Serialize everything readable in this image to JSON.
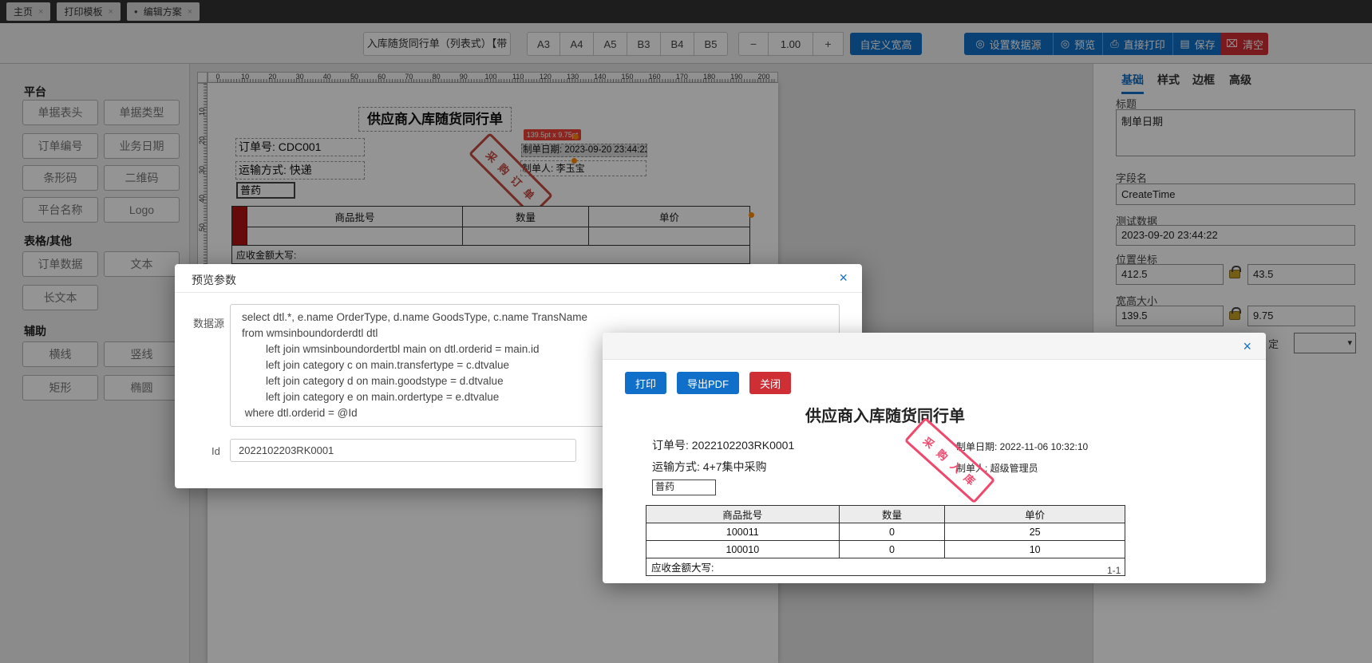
{
  "colors": {
    "primary": "#1070c9",
    "danger": "#cf2e35",
    "tabbar_bg": "#333333",
    "stamp_canvas": "#c64a43",
    "stamp_preview": "#f0486d",
    "selection_orange": "#ff8a00",
    "tooltip_red": "#ef4136",
    "table_marker_red": "#b01212",
    "lock_gold": "#c9a227"
  },
  "icons": {
    "close": "×",
    "eye": "◎",
    "printer": "⎙",
    "save": "▤",
    "trash": "⌧",
    "minus": "−",
    "plus": "+",
    "bullet": "●",
    "chevron_down": "▾"
  },
  "tabbar": {
    "tabs": [
      {
        "label": "主页"
      },
      {
        "label": "打印模板"
      },
      {
        "label": "编辑方案"
      }
    ]
  },
  "toolbar": {
    "template_name": "入库随货同行单（列表式）【带",
    "paper_sizes": [
      "A3",
      "A4",
      "A5",
      "B3",
      "B4",
      "B5"
    ],
    "zoom_value": "1.00",
    "custom_size_label": "自定义宽高",
    "datasource_label": "设置数据源",
    "preview_label": "预览",
    "print_label": "直接打印",
    "save_label": "保存",
    "clear_label": "清空"
  },
  "sidebar": {
    "sections": [
      {
        "title": "平台",
        "items": [
          "单据表头",
          "单据类型",
          "订单编号",
          "业务日期",
          "条形码",
          "二维码",
          "平台名称",
          "Logo"
        ]
      },
      {
        "title": "表格/其他",
        "items": [
          "订单数据",
          "文本",
          "长文本"
        ]
      },
      {
        "title": "辅助",
        "items": [
          "横线",
          "竖线",
          "矩形",
          "椭圆"
        ]
      }
    ]
  },
  "canvas": {
    "ruler_h": [
      "0",
      "10",
      "20",
      "30",
      "40",
      "50",
      "60",
      "70",
      "80",
      "90",
      "100",
      "110",
      "120",
      "130",
      "140",
      "150",
      "160",
      "170",
      "180",
      "190",
      "200"
    ],
    "ruler_v": [
      "10",
      "20",
      "30",
      "40",
      "50"
    ],
    "doc": {
      "title": "供应商入库随货同行单",
      "order_no": "订单号: CDC001",
      "transport": "运输方式: 快递",
      "drug_type": "普药",
      "size_tooltip": "139.5pt x 9.75pt",
      "make_date": "制单日期: 2023-09-20 23:44:22",
      "maker": "制单人: 李玉宝",
      "stamp": "采购订单",
      "columns": [
        "商品批号",
        "数量",
        "单价"
      ],
      "amount_label": "应收金额大写:"
    }
  },
  "inspector": {
    "tabs": [
      "基础",
      "样式",
      "边框",
      "高级"
    ],
    "active_tab": "基础",
    "title_label": "标题",
    "title_value": "制单日期",
    "field_label": "字段名",
    "field_value": "CreateTime",
    "test_label": "测试数据",
    "test_value": "2023-09-20 23:44:22",
    "position_label": "位置坐标",
    "position_x": "412.5",
    "position_y": "43.5",
    "size_label": "宽高大小",
    "size_w": "139.5",
    "size_h": "9.75",
    "partial_label": "定"
  },
  "params_modal": {
    "title": "预览参数",
    "datasource_label": "数据源",
    "sql_lines": [
      "select dtl.*, e.name OrderType, d.name GoodsType, c.name TransName",
      "from wmsinboundorderdtl dtl",
      "        left join wmsinboundordertbl main on dtl.orderid = main.id",
      "        left join category c on main.transfertype = c.dtvalue",
      "        left join category d on main.goodstype = d.dtvalue",
      "        left join category e on main.ordertype = e.dtvalue",
      " where dtl.orderid = @Id"
    ],
    "id_label": "Id",
    "id_value": "2022102203RK0001"
  },
  "preview_modal": {
    "print_label": "打印",
    "export_label": "导出PDF",
    "close_label": "关闭",
    "doc": {
      "title": "供应商入库随货同行单",
      "order_no": "订单号: 2022102203RK0001",
      "make_date": "制单日期: 2022-11-06 10:32:10",
      "transport": "运输方式: 4+7集中采购",
      "maker": "制单人: 超级管理员",
      "drug_type": "普药",
      "stamp": "采购入库",
      "table": {
        "headers": [
          "商品批号",
          "数量",
          "单价"
        ],
        "rows": [
          [
            "100011",
            "0",
            "25"
          ],
          [
            "100010",
            "0",
            "10"
          ]
        ],
        "footer": "应收金额大写:"
      },
      "page": "1-1"
    }
  }
}
